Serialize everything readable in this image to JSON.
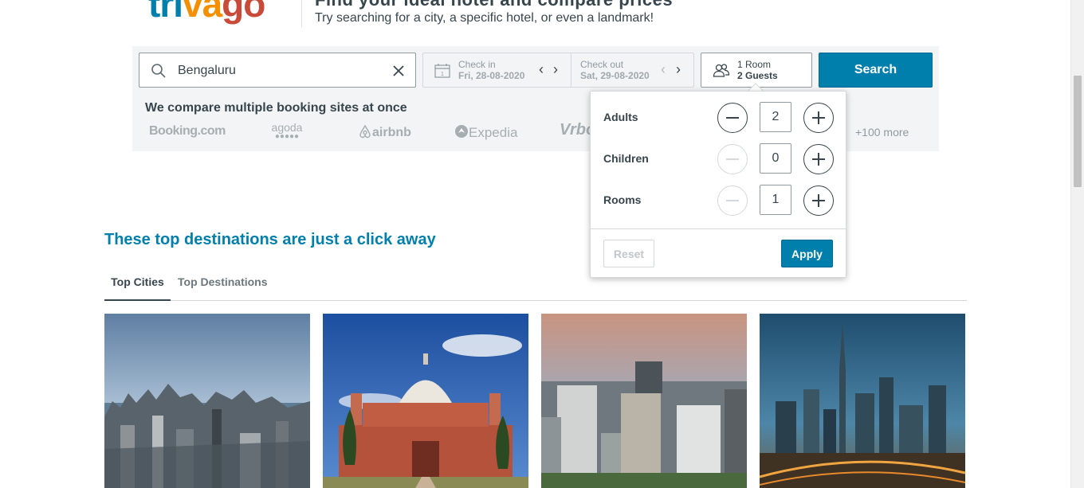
{
  "header": {
    "logo_part1": "tri",
    "logo_part2": "va",
    "logo_part3": "go",
    "headline": "Find your ideal hotel and compare prices",
    "tagline": "Try searching for a city, a specific hotel, or even a landmark!"
  },
  "search": {
    "destination_value": "Bengaluru",
    "checkin_label": "Check in",
    "checkin_value": "Fri, 28-08-2020",
    "checkout_label": "Check out",
    "checkout_value": "Sat, 29-08-2020",
    "rooms_text": "1 Room",
    "guests_text": "2 Guests",
    "search_button": "Search"
  },
  "compare": {
    "title": "We compare multiple booking sites at once",
    "partners": [
      "Booking.com",
      "agoda",
      "airbnb",
      "Expedia",
      "Vrbo"
    ],
    "more": "+100 more"
  },
  "guest_popup": {
    "rows": [
      {
        "label": "Adults",
        "value": "2",
        "minus_enabled": true
      },
      {
        "label": "Children",
        "value": "0",
        "minus_enabled": false
      },
      {
        "label": "Rooms",
        "value": "1",
        "minus_enabled": false
      }
    ],
    "reset_label": "Reset",
    "apply_label": "Apply"
  },
  "destinations": {
    "title": "These top destinations are just a click away",
    "tabs": [
      "Top Cities",
      "Top Destinations"
    ]
  },
  "colors": {
    "brand_blue": "#007fad",
    "text": "#37454d"
  }
}
